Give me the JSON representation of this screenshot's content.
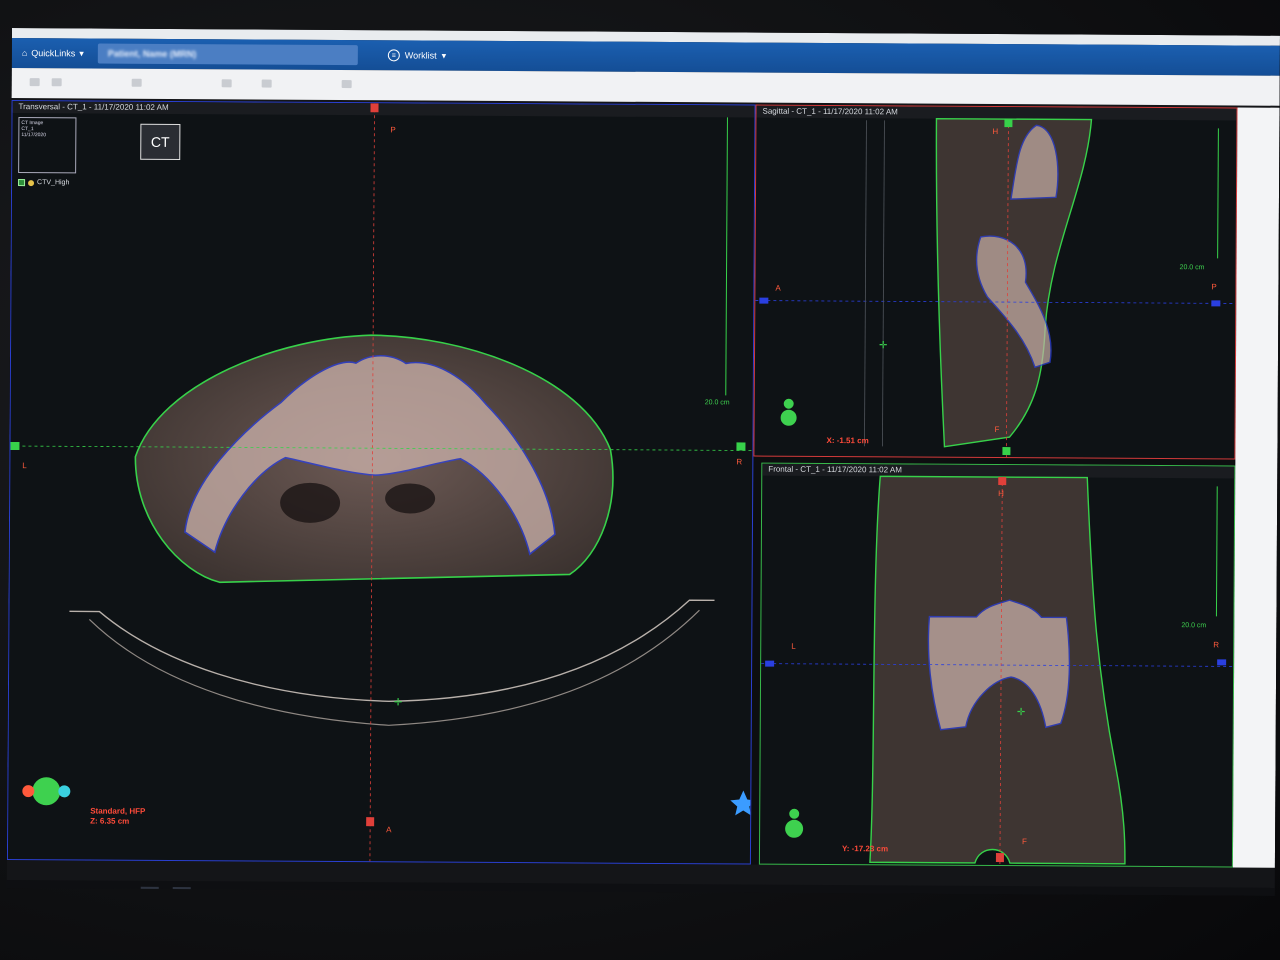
{
  "nav": {
    "home_label": "QuickLinks",
    "patient_name": "Patient, Name (MRN)",
    "worklist_label": "Worklist"
  },
  "transversal": {
    "title": "Transversal - CT_1 - 11/17/2020 11:02 AM",
    "thumb_lines": [
      "CT Image",
      "CT_1",
      "11/17/2020"
    ],
    "badge": "CT",
    "structure": "CTV_High",
    "orient_top": "P",
    "orient_bottom": "A",
    "orient_left": "L",
    "orient_right": "R",
    "scale": "20.0 cm",
    "readout_line1": "Standard, HFP",
    "readout_line2": "Z: 6.35 cm"
  },
  "sagittal": {
    "title": "Sagittal - CT_1 - 11/17/2020 11:02 AM",
    "orient_top": "H",
    "orient_bottom": "F",
    "orient_left": "A",
    "orient_right": "P",
    "scale": "20.0 cm",
    "readout": "X: -1.51 cm"
  },
  "frontal": {
    "title": "Frontal - CT_1 - 11/17/2020 11:02 AM",
    "orient_top": "H",
    "orient_bottom": "F",
    "orient_left": "L",
    "orient_right": "R",
    "scale": "20.0 cm",
    "readout": "Y: -17.23 cm"
  },
  "colors": {
    "body_contour": "#37d14a",
    "bone_contour": "#2a3fe0",
    "crosshair_vertical": "#e0403a",
    "crosshair_horizontal": "#37d14a"
  }
}
